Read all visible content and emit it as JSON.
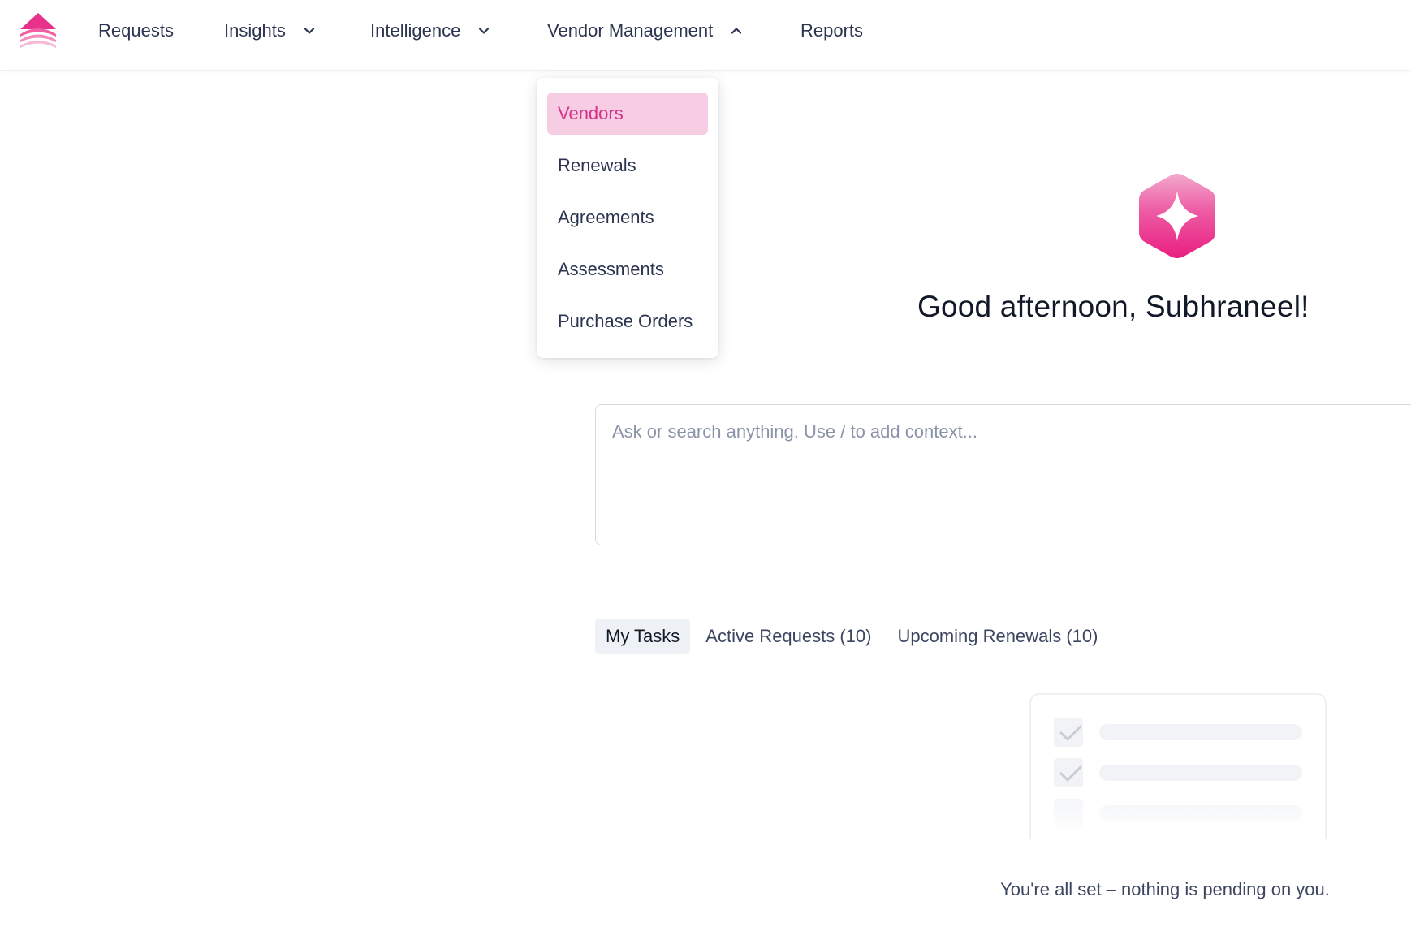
{
  "nav": {
    "items": [
      {
        "label": "Requests",
        "has_menu": false
      },
      {
        "label": "Insights",
        "has_menu": true,
        "expanded": false
      },
      {
        "label": "Intelligence",
        "has_menu": true,
        "expanded": false
      },
      {
        "label": "Vendor Management",
        "has_menu": true,
        "expanded": true
      },
      {
        "label": "Reports",
        "has_menu": false
      }
    ],
    "logo_icon": "stacked-chevron-logo-icon"
  },
  "vendor_menu": {
    "items": [
      {
        "label": "Vendors",
        "active": true
      },
      {
        "label": "Renewals"
      },
      {
        "label": "Agreements"
      },
      {
        "label": "Assessments"
      },
      {
        "label": "Purchase Orders"
      }
    ]
  },
  "hero": {
    "icon": "sparkle-hexagon-icon",
    "greeting": "Good afternoon, Subhraneel!"
  },
  "prompt": {
    "placeholder": "Ask or search anything. Use / to add context...",
    "value": ""
  },
  "tabs": [
    {
      "label": "My Tasks",
      "active": true
    },
    {
      "label": "Active Requests (10)"
    },
    {
      "label": "Upcoming Renewals (10)"
    }
  ],
  "empty_state": {
    "message": "You're all set – nothing is pending on you.",
    "illustration": "task-checklist-icon"
  },
  "colors": {
    "brand_pink": "#e8318a",
    "active_menu_bg": "#f6cde2",
    "active_menu_text": "#d6318a",
    "text_primary": "#111827",
    "text_secondary": "#2b3550"
  }
}
